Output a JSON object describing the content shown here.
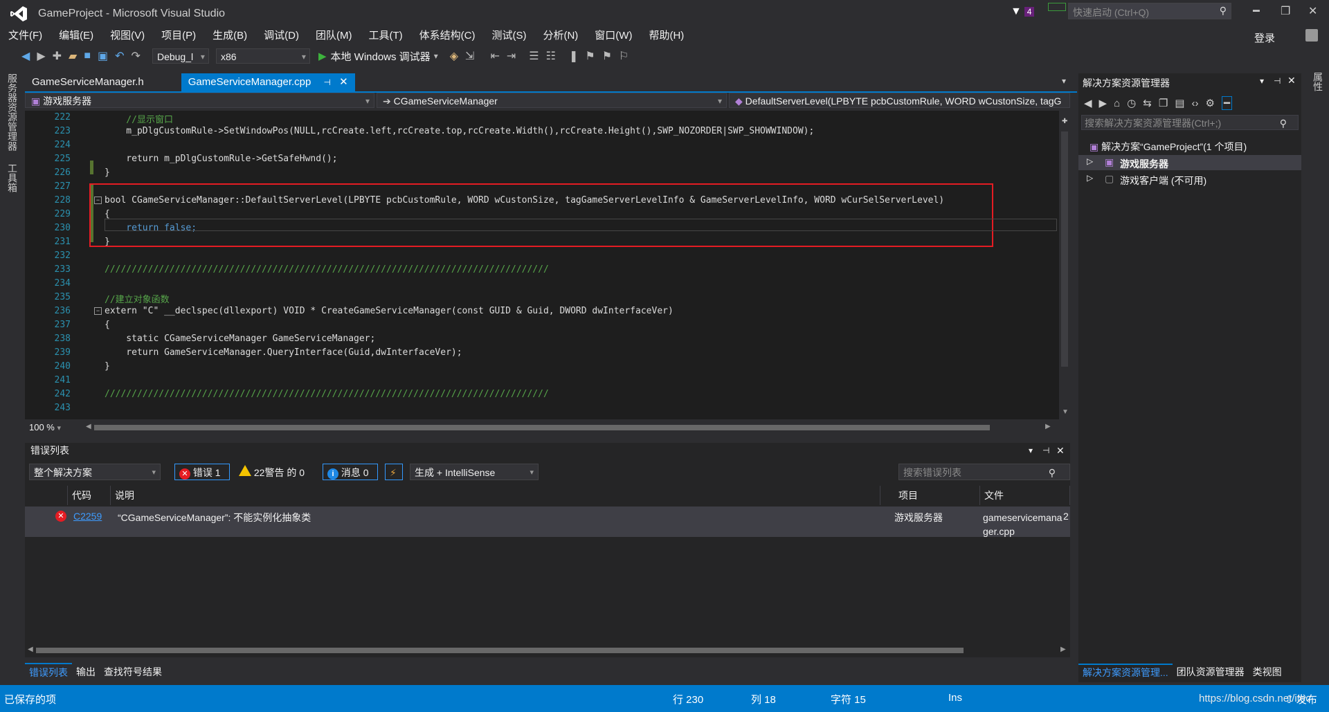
{
  "window": {
    "title": "GameProject - Microsoft Visual Studio",
    "notification_count": "4",
    "quick_launch_placeholder": "快速启动 (Ctrl+Q)",
    "login": "登录"
  },
  "menu": [
    "文件(F)",
    "编辑(E)",
    "视图(V)",
    "项目(P)",
    "生成(B)",
    "调试(D)",
    "团队(M)",
    "工具(T)",
    "体系结构(C)",
    "测试(S)",
    "分析(N)",
    "窗口(W)",
    "帮助(H)"
  ],
  "toolbar": {
    "config": "Debug_l",
    "platform": "x86",
    "debugger": "本地 Windows 调试器"
  },
  "left_strip": [
    "服务器资源管理器",
    "工具箱"
  ],
  "tabs": [
    {
      "label": "GameServiceManager.h",
      "active": false
    },
    {
      "label": "GameServiceManager.cpp",
      "active": true
    }
  ],
  "navbar": {
    "project": "游戏服务器",
    "class": "CGameServiceManager",
    "member": "DefaultServerLevel(LPBYTE pcbCustomRule, WORD wCustonSize, tagG"
  },
  "code_lines": [
    {
      "n": "222",
      "text": "    //显示窗口"
    },
    {
      "n": "223",
      "text": "    m_pDlgCustomRule->SetWindowPos(NULL,rcCreate.left,rcCreate.top,rcCreate.Width(),rcCreate.Height(),SWP_NOZORDER|SWP_SHOWWINDOW);"
    },
    {
      "n": "224",
      "text": ""
    },
    {
      "n": "225",
      "text": "    return m_pDlgCustomRule->GetSafeHwnd();"
    },
    {
      "n": "226",
      "text": "}"
    },
    {
      "n": "227",
      "text": ""
    },
    {
      "n": "228",
      "text": "bool CGameServiceManager::DefaultServerLevel(LPBYTE pcbCustomRule, WORD wCustonSize, tagGameServerLevelInfo & GameServerLevelInfo, WORD wCurSelServerLevel)"
    },
    {
      "n": "229",
      "text": "{"
    },
    {
      "n": "230",
      "text": "    return false;"
    },
    {
      "n": "231",
      "text": "}"
    },
    {
      "n": "232",
      "text": ""
    },
    {
      "n": "233",
      "text": "//////////////////////////////////////////////////////////////////////////////////"
    },
    {
      "n": "234",
      "text": ""
    },
    {
      "n": "235",
      "text": "//建立对象函数"
    },
    {
      "n": "236",
      "text": "extern \"C\" __declspec(dllexport) VOID * CreateGameServiceManager(const GUID & Guid, DWORD dwInterfaceVer)"
    },
    {
      "n": "237",
      "text": "{"
    },
    {
      "n": "238",
      "text": "    static CGameServiceManager GameServiceManager;"
    },
    {
      "n": "239",
      "text": "    return GameServiceManager.QueryInterface(Guid,dwInterfaceVer);"
    },
    {
      "n": "240",
      "text": "}"
    },
    {
      "n": "241",
      "text": ""
    },
    {
      "n": "242",
      "text": "//////////////////////////////////////////////////////////////////////////////////"
    },
    {
      "n": "243",
      "text": ""
    }
  ],
  "zoom": "100 %",
  "error_list": {
    "title": "错误列表",
    "scope": "整个解决方案",
    "errors_btn": "错误 1",
    "warnings_btn": "22警告 的 0",
    "messages_btn": "消息 0",
    "source": "生成 + IntelliSense",
    "search_placeholder": "搜索错误列表",
    "columns": {
      "code": "代码",
      "desc": "说明",
      "project": "项目",
      "file": "文件"
    },
    "rows": [
      {
        "code": "C2259",
        "desc": "“CGameServiceManager”: 不能实例化抽象类",
        "project": "游戏服务器",
        "file": "gameservicemana ger.cpp",
        "line": "2"
      }
    ]
  },
  "bottom_tabs": [
    "错误列表",
    "输出",
    "查找符号结果"
  ],
  "solution_explorer": {
    "title": "解决方案资源管理器",
    "search_placeholder": "搜索解决方案资源管理器(Ctrl+;)",
    "solution": "解决方案“GameProject”(1 个项目)",
    "items": [
      {
        "label": "游戏服务器",
        "bold": true
      },
      {
        "label": "游戏客户端 (不可用)",
        "bold": false
      }
    ],
    "bottom_tabs": [
      "解决方案资源管理...",
      "团队资源管理器",
      "类视图"
    ]
  },
  "right_strip": "属性",
  "status": {
    "left": "已保存的项",
    "row": "行 230",
    "col": "列 18",
    "char": "字符 15",
    "mode": "Ins",
    "publish": "发布",
    "watermark": "https://blog.csdn.net/itec"
  },
  "colors": {
    "accent": "#007acc",
    "redbox": "#e51c23",
    "editor_bg": "#1e1e1e"
  }
}
